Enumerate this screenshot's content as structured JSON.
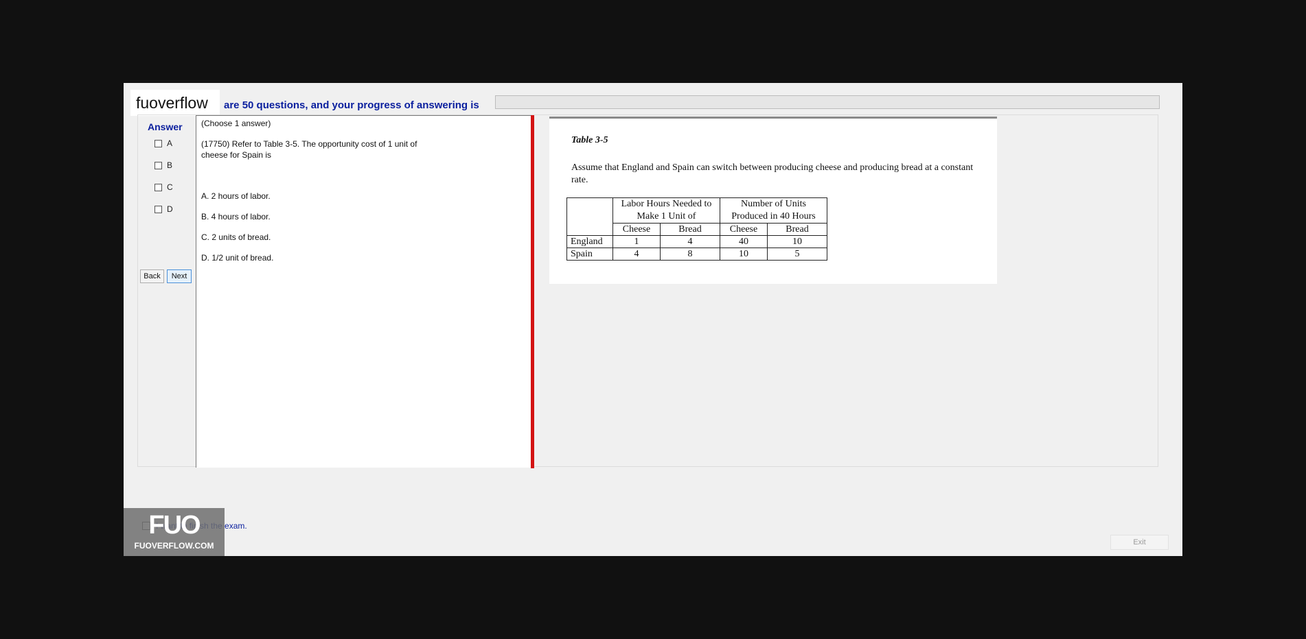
{
  "watermark": {
    "top_text": "fuoverflow",
    "logo_big": "FUO",
    "logo_small": "FUOVERFLOW.COM"
  },
  "progress": {
    "text": "are 50 questions, and your progress of answering is",
    "value_fraction": 0.0
  },
  "answer": {
    "heading": "Answer",
    "options": [
      {
        "label": "A"
      },
      {
        "label": "B"
      },
      {
        "label": "C"
      },
      {
        "label": "D"
      }
    ],
    "back_label": "Back",
    "next_label": "Next"
  },
  "question": {
    "instruction": "(Choose 1 answer)",
    "stem": "(17750)  Refer to Table 3-5.  The opportunity cost of 1 unit of cheese for Spain is",
    "choices": [
      "A.  2 hours of labor.",
      "B.  4 hours of labor.",
      "C.  2 units of bread.",
      "D.  1/2 unit of bread."
    ]
  },
  "figure": {
    "title": "Table 3-5",
    "description": "Assume that England and Spain can switch between producing cheese and producing bread at a constant rate.",
    "group_headers": [
      "Labor Hours Needed to Make 1 Unit of",
      "Number of Units Produced in 40 Hours"
    ],
    "sub_headers": [
      "Cheese",
      "Bread",
      "Cheese",
      "Bread"
    ],
    "rows": [
      {
        "country": "England",
        "values": [
          "1",
          "4",
          "40",
          "10"
        ]
      },
      {
        "country": "Spain",
        "values": [
          "4",
          "8",
          "10",
          "5"
        ]
      }
    ]
  },
  "footer": {
    "finish_text": "I want to finish the exam.",
    "exit_label": "Exit"
  },
  "colors": {
    "accent_text": "#0a1f9e",
    "divider_red": "#d31313",
    "progress_green": "#06b025"
  }
}
